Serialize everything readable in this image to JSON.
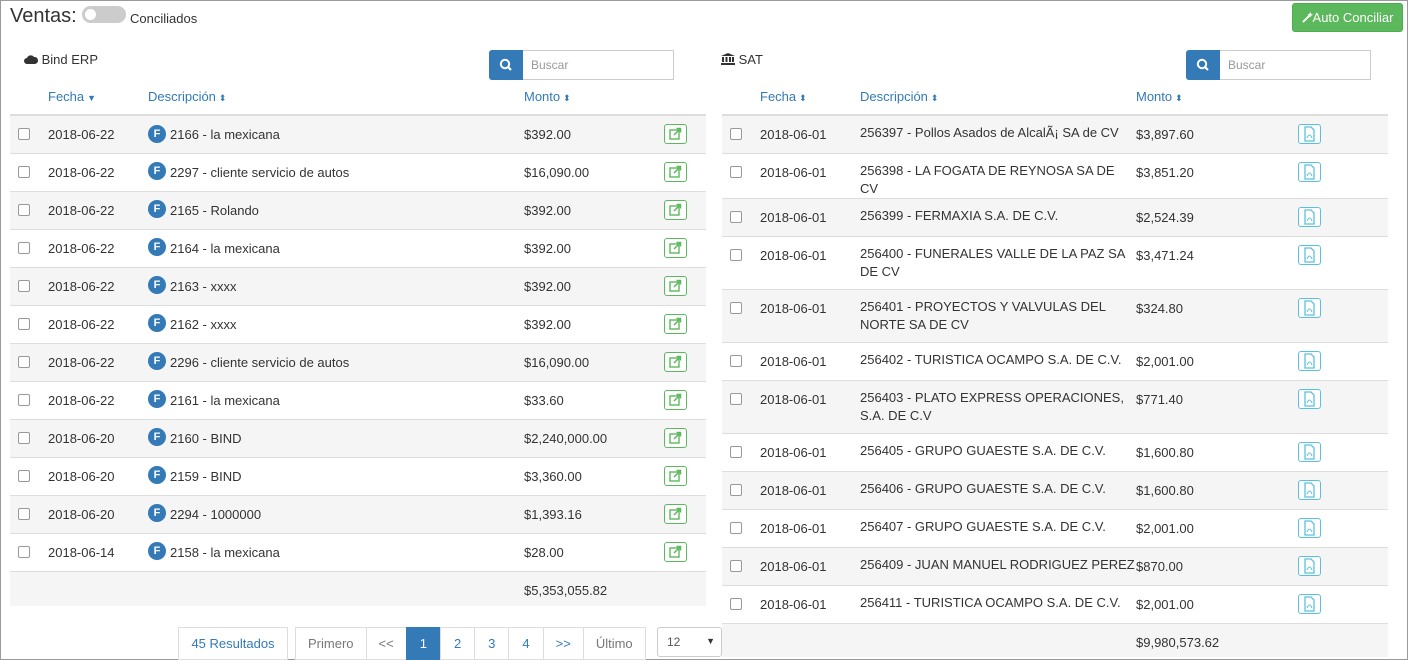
{
  "header": {
    "title": "Ventas:",
    "toggle_label": "Conciliados",
    "auto_button": "Auto Conciliar"
  },
  "left": {
    "source_label": "Bind ERP",
    "search_placeholder": "Buscar",
    "columns": [
      "Fecha",
      "Descripción",
      "Monto"
    ],
    "rows": [
      {
        "fecha": "2018-06-22",
        "badge": "F",
        "desc": "2166 - la mexicana",
        "monto": "$392.00"
      },
      {
        "fecha": "2018-06-22",
        "badge": "F",
        "desc": "2297 - cliente servicio de autos",
        "monto": "$16,090.00"
      },
      {
        "fecha": "2018-06-22",
        "badge": "F",
        "desc": "2165 - Rolando",
        "monto": "$392.00"
      },
      {
        "fecha": "2018-06-22",
        "badge": "F",
        "desc": "2164 - la mexicana",
        "monto": "$392.00"
      },
      {
        "fecha": "2018-06-22",
        "badge": "F",
        "desc": "2163 - xxxx",
        "monto": "$392.00"
      },
      {
        "fecha": "2018-06-22",
        "badge": "F",
        "desc": "2162 - xxxx",
        "monto": "$392.00"
      },
      {
        "fecha": "2018-06-22",
        "badge": "F",
        "desc": "2296 - cliente servicio de autos",
        "monto": "$16,090.00"
      },
      {
        "fecha": "2018-06-22",
        "badge": "F",
        "desc": "2161 - la mexicana",
        "monto": "$33.60"
      },
      {
        "fecha": "2018-06-20",
        "badge": "F",
        "desc": "2160 - BIND",
        "monto": "$2,240,000.00"
      },
      {
        "fecha": "2018-06-20",
        "badge": "F",
        "desc": "2159 - BIND",
        "monto": "$3,360.00"
      },
      {
        "fecha": "2018-06-20",
        "badge": "F",
        "desc": "2294 - 1000000",
        "monto": "$1,393.16"
      },
      {
        "fecha": "2018-06-14",
        "badge": "F",
        "desc": "2158 - la mexicana",
        "monto": "$28.00"
      }
    ],
    "total": "$5,353,055.82"
  },
  "right": {
    "source_label": "SAT",
    "search_placeholder": "Buscar",
    "columns": [
      "Fecha",
      "Descripción",
      "Monto"
    ],
    "rows": [
      {
        "fecha": "2018-06-01",
        "desc": "256397 - Pollos Asados de AlcalÃ¡ SA de CV",
        "monto": "$3,897.60"
      },
      {
        "fecha": "2018-06-01",
        "desc": "256398 - LA FOGATA DE REYNOSA SA DE CV",
        "monto": "$3,851.20"
      },
      {
        "fecha": "2018-06-01",
        "desc": "256399 - FERMAXIA S.A. DE C.V.",
        "monto": "$2,524.39"
      },
      {
        "fecha": "2018-06-01",
        "desc": "256400 - FUNERALES VALLE DE LA PAZ SA DE CV",
        "monto": "$3,471.24"
      },
      {
        "fecha": "2018-06-01",
        "desc": "256401 - PROYECTOS Y VALVULAS DEL NORTE SA DE CV",
        "monto": "$324.80"
      },
      {
        "fecha": "2018-06-01",
        "desc": "256402 - TURISTICA OCAMPO S.A. DE C.V.",
        "monto": "$2,001.00"
      },
      {
        "fecha": "2018-06-01",
        "desc": "256403 - PLATO EXPRESS OPERACIONES, S.A. DE C.V",
        "monto": "$771.40"
      },
      {
        "fecha": "2018-06-01",
        "desc": "256405 - GRUPO GUAESTE S.A. DE C.V.",
        "monto": "$1,600.80"
      },
      {
        "fecha": "2018-06-01",
        "desc": "256406 - GRUPO GUAESTE S.A. DE C.V.",
        "monto": "$1,600.80"
      },
      {
        "fecha": "2018-06-01",
        "desc": "256407 - GRUPO GUAESTE S.A. DE C.V.",
        "monto": "$2,001.00"
      },
      {
        "fecha": "2018-06-01",
        "desc": "256409 - JUAN MANUEL RODRIGUEZ PEREZ",
        "monto": "$870.00"
      },
      {
        "fecha": "2018-06-01",
        "desc": "256411 - TURISTICA OCAMPO S.A. DE C.V.",
        "monto": "$2,001.00"
      }
    ],
    "total": "$9,980,573.62"
  },
  "pagination": {
    "results": "45 Resultados",
    "pages": [
      "Primero",
      "<<",
      "1",
      "2",
      "3",
      "4",
      ">>",
      "Último"
    ],
    "active_page": "1",
    "per_page": "12"
  },
  "icons": {
    "left_source": "cloud-icon",
    "right_source": "bank-icon",
    "search": "search-icon",
    "row_action_left": "external-link-icon",
    "row_action_right": "pdf-file-icon",
    "auto_button": "magic-wand-icon"
  },
  "colors": {
    "primary": "#337ab7",
    "success": "#5cb85c",
    "info": "#5bc0de",
    "stripe": "#f5f5f5"
  }
}
